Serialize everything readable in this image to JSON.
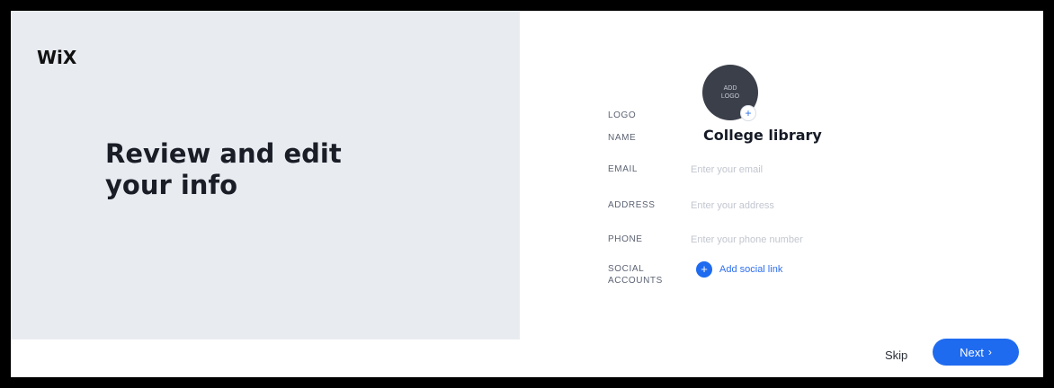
{
  "brand": {
    "logo_text": "WiX"
  },
  "left": {
    "headline_line1": "Review and edit",
    "headline_line2": "your info"
  },
  "form": {
    "logo": {
      "label": "LOGO",
      "avatar_text": "ADD LOGO",
      "plus_icon": "+"
    },
    "name": {
      "label": "NAME",
      "value": "College library"
    },
    "email": {
      "label": "EMAIL",
      "placeholder": "Enter your email"
    },
    "address": {
      "label": "ADDRESS",
      "placeholder": "Enter your address"
    },
    "phone": {
      "label": "PHONE",
      "placeholder": "Enter your phone number"
    },
    "social": {
      "label_line1": "SOCIAL",
      "label_line2": "ACCOUNTS",
      "add_link": "Add social link",
      "plus_icon": "+"
    }
  },
  "footer": {
    "skip": "Skip",
    "next": "Next",
    "next_icon": "›"
  },
  "colors": {
    "accent": "#1f6bf0",
    "left_bg": "#e8ecf1",
    "avatar_bg": "#3b3f4a"
  }
}
